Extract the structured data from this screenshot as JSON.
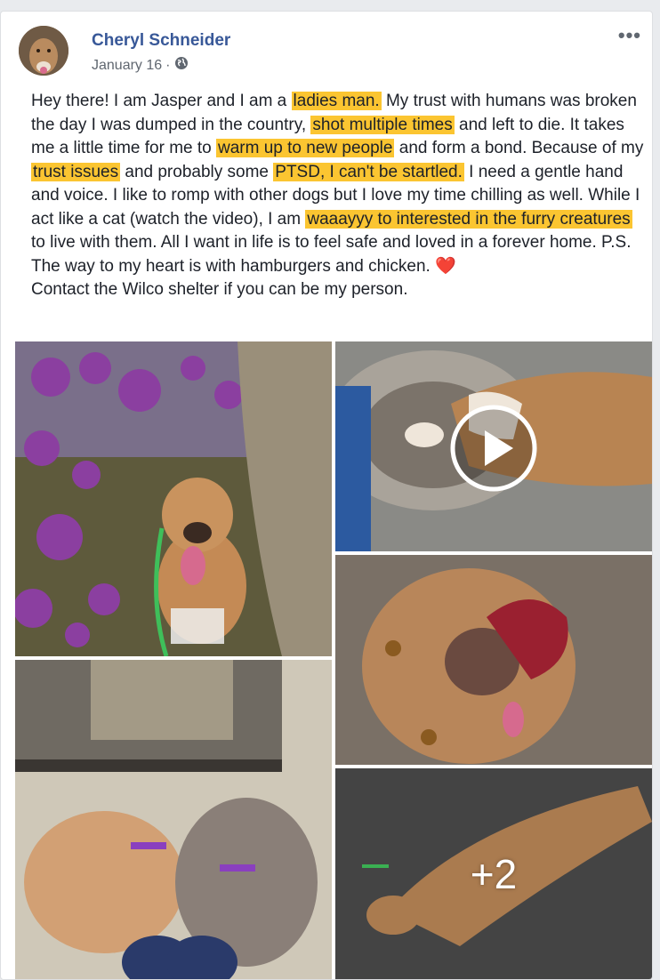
{
  "post": {
    "author": "Cheryl Schneider",
    "date": "January 16",
    "separator": "·",
    "privacy_icon": "globe-icon",
    "more_label": "•••",
    "text_segments": [
      {
        "t": "Hey there! I am Jasper and I am a ",
        "h": false
      },
      {
        "t": "ladies man.",
        "h": true
      },
      {
        "t": " My trust with humans was broken the day I was dumped in the country, ",
        "h": false
      },
      {
        "t": "shot multiple times",
        "h": true
      },
      {
        "t": " and left to die. It takes me a little time for me to ",
        "h": false
      },
      {
        "t": "warm up to new people",
        "h": true
      },
      {
        "t": " and form a bond. Because of my ",
        "h": false
      },
      {
        "t": "trust issues",
        "h": true
      },
      {
        "t": " and probably some ",
        "h": false
      },
      {
        "t": "PTSD, I can't be startled.",
        "h": true
      },
      {
        "t": " I need a gentle hand and voice. I like to romp with other dogs but I love my time chilling as well. While I act like a cat (watch the video), I am ",
        "h": false
      },
      {
        "t": "waaayyy to interested in the furry creatures",
        "h": true
      },
      {
        "t": " to live with them. All I want in life is to feel safe and loved in a forever home. P.S. The way to my heart is with hamburgers and chicken. ",
        "h": false
      },
      {
        "t": "❤️",
        "h": false,
        "emoji": true
      },
      {
        "t": "\nContact the Wilco shelter if you can be my person.",
        "h": false
      }
    ],
    "highlight_color": "#fbc531"
  },
  "media": {
    "more_count": "+2",
    "play_icon": "play-icon"
  },
  "colors": {
    "name": "#385898",
    "meta": "#606770",
    "heart": "#e0245e"
  }
}
